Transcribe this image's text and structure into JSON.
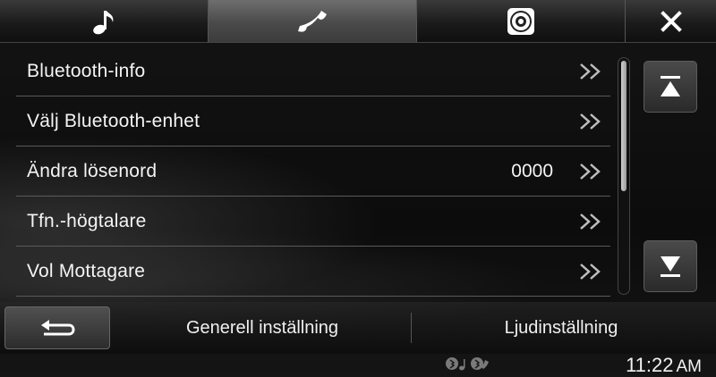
{
  "tabs": [
    {
      "name": "audio",
      "icon": "music-note-icon",
      "active": false
    },
    {
      "name": "phone",
      "icon": "phone-icon",
      "active": true
    },
    {
      "name": "disc",
      "icon": "disc-icon",
      "active": false
    },
    {
      "name": "close",
      "icon": "close-icon",
      "active": false
    }
  ],
  "list": {
    "items": [
      {
        "label": "Bluetooth-info",
        "value": ""
      },
      {
        "label": "Välj Bluetooth-enhet",
        "value": ""
      },
      {
        "label": "Ändra lösenord",
        "value": "0000"
      },
      {
        "label": "Tfn.-högtalare",
        "value": ""
      },
      {
        "label": "Vol Mottagare",
        "value": ""
      }
    ],
    "item_icon": "double-chevron-right-icon"
  },
  "scroll": {
    "top_icon": "scroll-to-top-icon",
    "bottom_icon": "scroll-to-bottom-icon"
  },
  "bottom": {
    "back_icon": "back-arrow-icon",
    "general_label": "Generell inställning",
    "sound_label": "Ljudinställning"
  },
  "status": {
    "icons": [
      "bluetooth-audio-icon",
      "bluetooth-phone-icon"
    ],
    "time": "11:22",
    "ampm": "AM"
  },
  "colors": {
    "active_tab": "#4a4a4a",
    "text": "#f4f4f4",
    "divider": "#5a5a5a"
  }
}
